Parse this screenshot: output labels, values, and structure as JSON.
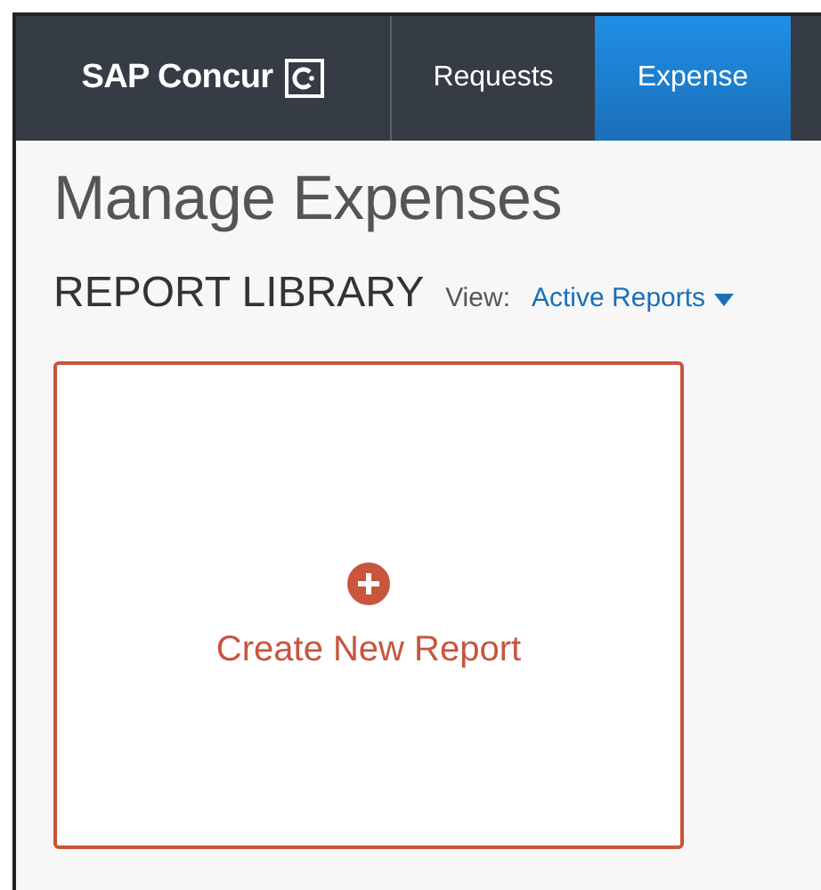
{
  "navbar": {
    "brand": "SAP Concur",
    "tabs": [
      {
        "label": "Requests",
        "selected": false
      },
      {
        "label": "Expense",
        "selected": true
      }
    ]
  },
  "page_title": "Manage Expenses",
  "section": {
    "title": "REPORT LIBRARY",
    "view_label": "View:",
    "view_value": "Active Reports"
  },
  "create_tile": {
    "label": "Create New Report"
  }
}
